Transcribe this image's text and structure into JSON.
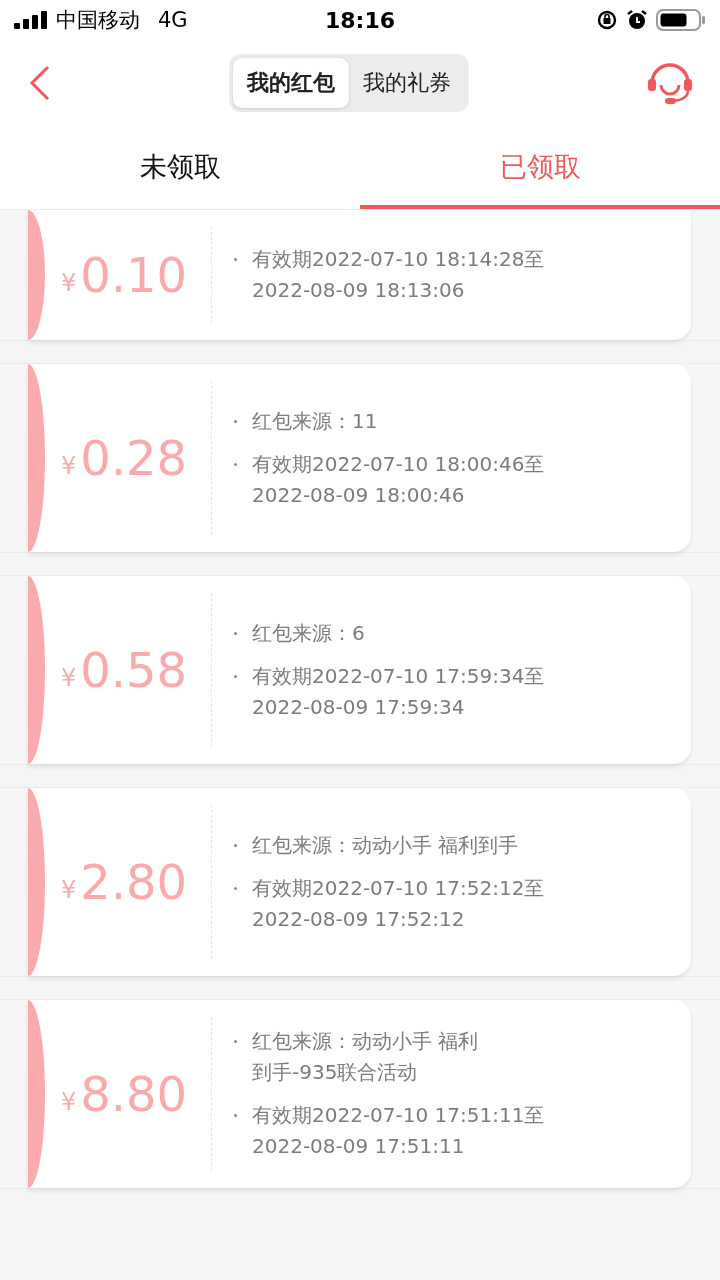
{
  "status_bar": {
    "carrier": "中国移动",
    "network": "4G",
    "time": "18:16"
  },
  "segments": [
    {
      "label": "我的红包",
      "selected": true
    },
    {
      "label": "我的礼券",
      "selected": false
    }
  ],
  "tabs": [
    {
      "label": "未领取",
      "selected": false
    },
    {
      "label": "已领取",
      "selected": true
    }
  ],
  "cards": [
    {
      "currency": "¥",
      "amount": "0.10",
      "validity_lines": [
        "有效期2022-07-10 18:14:28至",
        "2022-08-09 18:13:06"
      ],
      "clipped": true
    },
    {
      "currency": "¥",
      "amount": "0.28",
      "source_lines": [
        "红包来源：11"
      ],
      "validity_lines": [
        "有效期2022-07-10 18:00:46至",
        "2022-08-09 18:00:46"
      ]
    },
    {
      "currency": "¥",
      "amount": "0.58",
      "source_lines": [
        "红包来源：6"
      ],
      "validity_lines": [
        "有效期2022-07-10 17:59:34至",
        "2022-08-09 17:59:34"
      ]
    },
    {
      "currency": "¥",
      "amount": "2.80",
      "source_lines": [
        "红包来源：动动小手 福利到手"
      ],
      "validity_lines": [
        "有效期2022-07-10 17:52:12至",
        "2022-08-09 17:52:12"
      ]
    },
    {
      "currency": "¥",
      "amount": "8.80",
      "source_lines": [
        "红包来源：动动小手 福利",
        "到手-935联合活动"
      ],
      "validity_lines": [
        "有效期2022-07-10 17:51:11至",
        "2022-08-09 17:51:11"
      ]
    }
  ]
}
